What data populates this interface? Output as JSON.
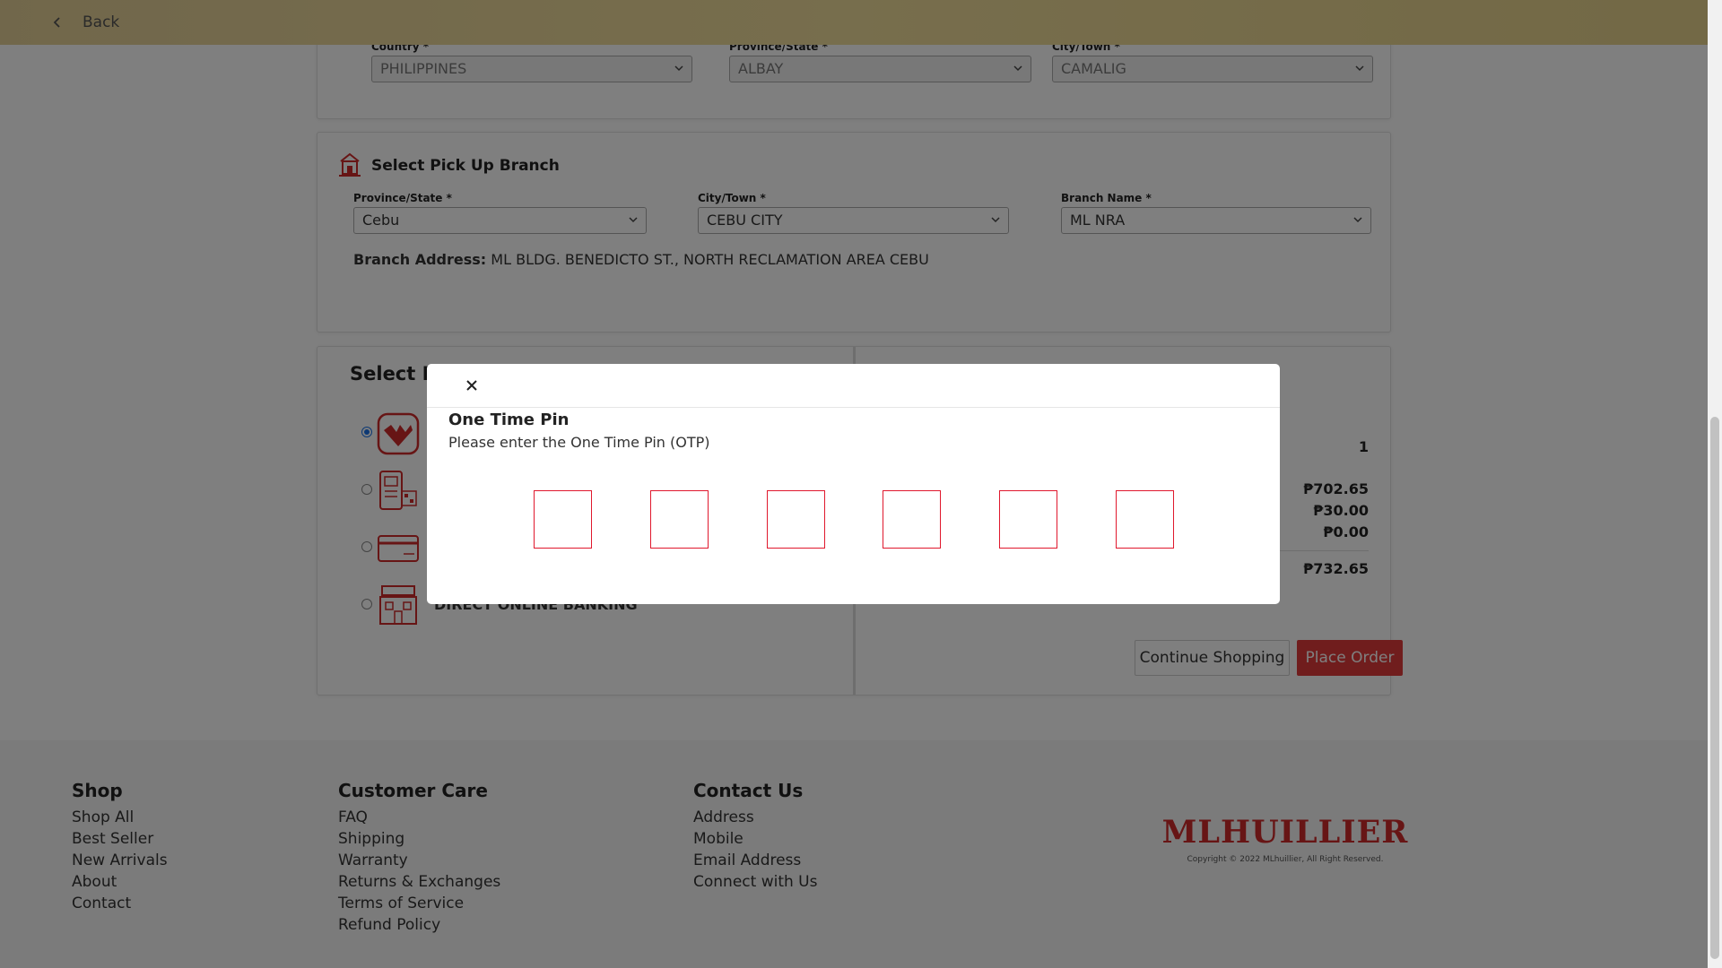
{
  "topbar": {
    "back_label": "Back"
  },
  "address": {
    "country_label": "Country *",
    "country_value": "PHILIPPINES",
    "province_label": "Province/State *",
    "province_value": "ALBAY",
    "city_label": "City/Town *",
    "city_value": "CAMALIG"
  },
  "pickup": {
    "title": "Select Pick Up Branch",
    "province_label": "Province/State *",
    "province_value": "Cebu",
    "city_label": "City/Town *",
    "city_value": "CEBU CITY",
    "branch_label": "Branch Name *",
    "branch_value": "ML NRA",
    "address_label": "Branch Address:",
    "address_value": "ML BLDG. BENEDICTO ST., NORTH RECLAMATION AREA CEBU"
  },
  "payment": {
    "title": "Select Po",
    "options": [
      {
        "label": "",
        "icon": "ml-wallet-icon",
        "selected": true
      },
      {
        "label": "",
        "icon": "qr-payment-icon",
        "selected": false
      },
      {
        "label": "",
        "icon": "card-icon",
        "selected": false
      },
      {
        "label": "DIRECT ONLINE BANKING",
        "icon": "bank-icon",
        "selected": false
      }
    ]
  },
  "summary": {
    "quantity": "1",
    "subtotal": "₱702.65",
    "shipping": "₱30.00",
    "discount": "₱0.00",
    "total": "₱732.65",
    "continue_label": "Continue Shopping",
    "place_order_label": "Place Order"
  },
  "modal": {
    "title": "One Time Pin",
    "subtitle": "Please enter the One Time Pin (OTP)",
    "otp_count": 6
  },
  "footer": {
    "shop": {
      "heading": "Shop",
      "links": [
        "Shop All",
        "Best Seller",
        "New Arrivals",
        "About",
        "Contact"
      ]
    },
    "care": {
      "heading": "Customer Care",
      "links": [
        "FAQ",
        "Shipping",
        "Warranty",
        "Returns & Exchanges",
        "Terms of Service",
        "Refund Policy"
      ]
    },
    "contact": {
      "heading": "Contact Us",
      "links": [
        "Address",
        "Mobile",
        "Email Address",
        "Connect with Us"
      ]
    },
    "logo_text": "MLHUILLIER",
    "copyright": "Copyright © 2022 MLhuillier, All Right Reserved."
  },
  "colors": {
    "brand_red": "#cf2a2a",
    "topbar_gold": "#e3cf97",
    "otp_border": "#e0182d"
  }
}
